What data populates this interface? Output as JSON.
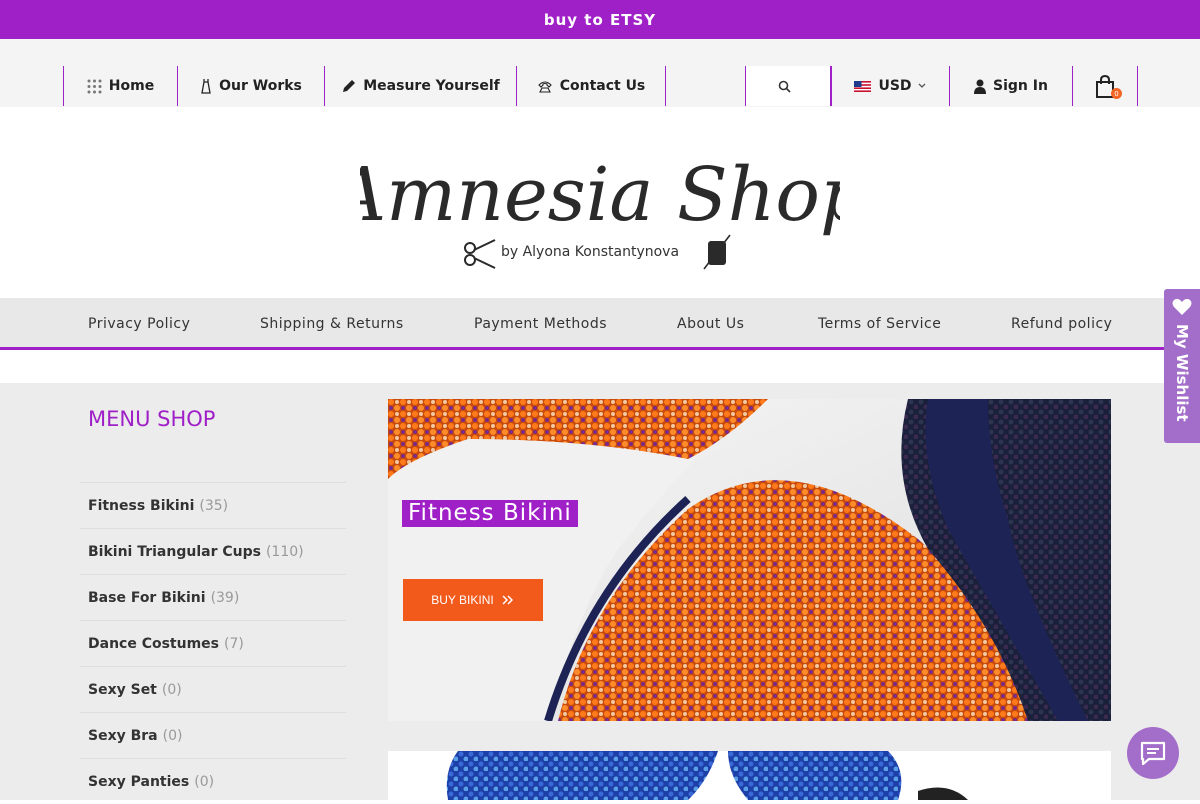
{
  "topbar": {
    "text": "buy to ETSY"
  },
  "nav": {
    "home": "Home",
    "works": "Our Works",
    "measure": "Measure Yourself",
    "contact": "Contact Us",
    "currency": "USD",
    "signin": "Sign In",
    "cart_count": "0"
  },
  "logo": {
    "name": "Amnesia Shop",
    "tagline": "by Alyona Konstantynova"
  },
  "policies": [
    "Privacy Policy",
    "Shipping & Returns",
    "Payment Methods",
    "About Us",
    "Terms of Service",
    "Refund policy"
  ],
  "sidebar": {
    "title": "MENU SHOP",
    "items": [
      {
        "label": "Fitness Bikini",
        "count": "(35)"
      },
      {
        "label": "Bikini Triangular Cups",
        "count": "(110)"
      },
      {
        "label": "Base For Bikini",
        "count": "(39)"
      },
      {
        "label": "Dance Costumes",
        "count": "(7)"
      },
      {
        "label": "Sexy Set",
        "count": "(0)"
      },
      {
        "label": "Sexy Bra",
        "count": "(0)"
      },
      {
        "label": "Sexy Panties",
        "count": "(0)"
      }
    ]
  },
  "banner": {
    "title": "Fitness Bikini",
    "button": "BUY BIKINI"
  },
  "wishlist": {
    "label": "My Wishlist"
  },
  "colors": {
    "brand": "#a020c8",
    "accent": "#f25a1c",
    "wishlist": "#a36ec9"
  },
  "icons": {
    "home": "grid-icon",
    "works": "dress-icon",
    "measure": "pencil-icon",
    "contact": "phone-icon",
    "search": "search-icon",
    "currency": "us-flag-icon",
    "signin": "user-icon",
    "cart": "bag-icon",
    "wishlist": "heart-icon",
    "chat": "chat-icon"
  }
}
